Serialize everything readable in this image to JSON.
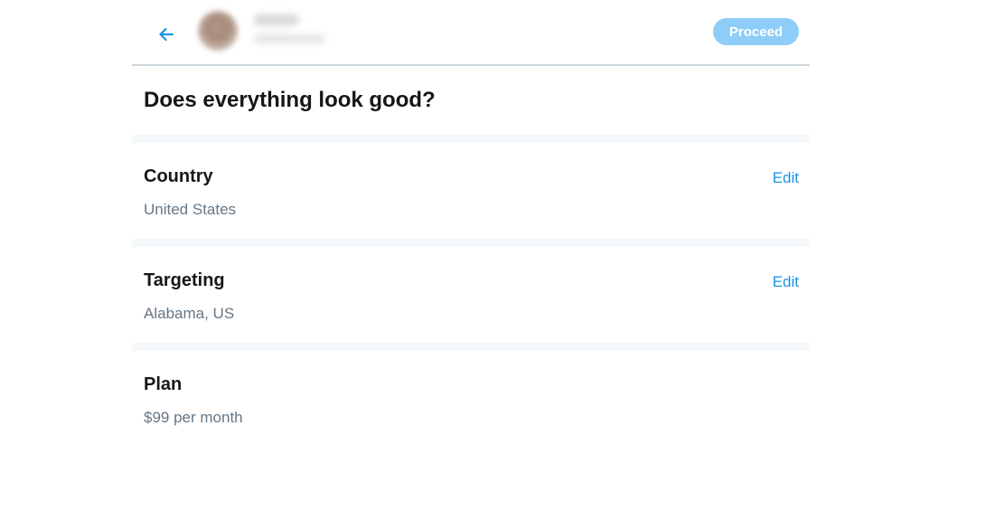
{
  "header": {
    "proceed_label": "Proceed"
  },
  "page": {
    "title": "Does everything look good?"
  },
  "sections": [
    {
      "label": "Country",
      "value": "United States",
      "edit_label": "Edit"
    },
    {
      "label": "Targeting",
      "value": "Alabama, US",
      "edit_label": "Edit"
    },
    {
      "label": "Plan",
      "value": "$99 per month"
    }
  ],
  "colors": {
    "accent": "#1b95e0",
    "proceed_disabled": "#8ecdf8",
    "divider": "#f5f8fa",
    "secondary_text": "#657786"
  },
  "icons": {
    "back": "arrow-left-icon"
  }
}
